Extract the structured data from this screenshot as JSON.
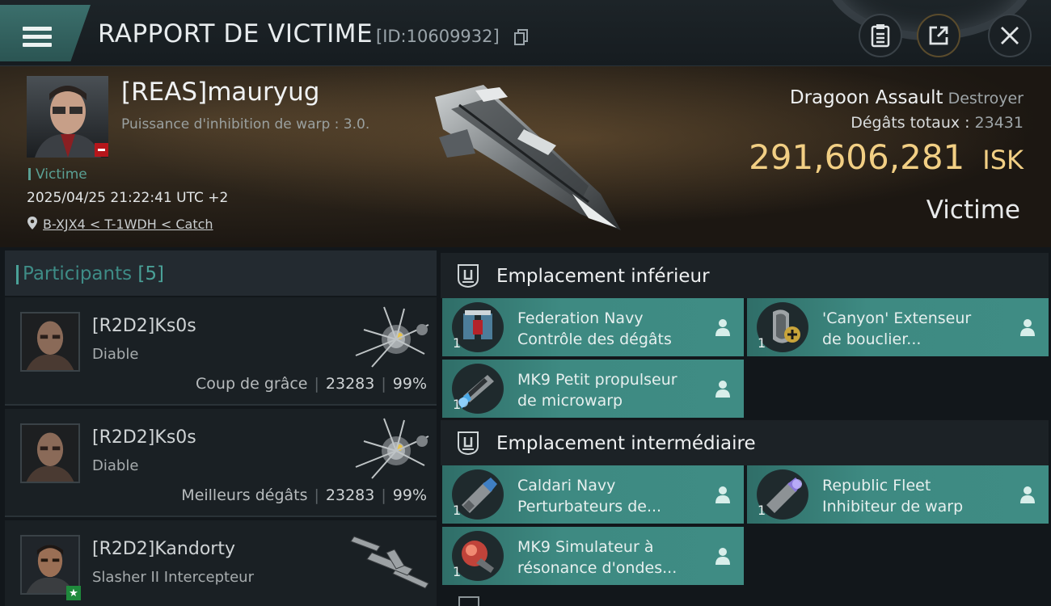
{
  "header": {
    "title": "RAPPORT DE VICTIME",
    "report_id": "[ID:10609932]",
    "icons": [
      "menu-icon",
      "copy-icon",
      "clipboard-icon",
      "share-icon",
      "close-icon"
    ]
  },
  "victim": {
    "name": "[REAS]mauryug",
    "subtitle": "Puissance d'inhibition de warp : 3.0.",
    "tag": "Victime",
    "datetime": "2025/04/25 21:22:41 UTC +2",
    "location": "B-XJX4 < T-1WDH < Catch",
    "ship_name": "Dragoon Assault",
    "ship_class": "Destroyer",
    "total_damage_label": "Dégâts totaux :",
    "total_damage": "23431",
    "isk_value": "291,606,281",
    "isk_unit": "ISK",
    "outcome_label": "Victime"
  },
  "participants": {
    "label": "Participants",
    "count": "[5]",
    "items": [
      {
        "name": "[R2D2]Ks0s",
        "ship": "Diable",
        "stat_label": "Coup de grâce",
        "damage": "23283",
        "percent": "99%"
      },
      {
        "name": "[R2D2]Ks0s",
        "ship": "Diable",
        "stat_label": "Meilleurs dégâts",
        "damage": "23283",
        "percent": "99%"
      },
      {
        "name": "[R2D2]Kandorty",
        "ship": "Slasher II Intercepteur"
      }
    ]
  },
  "fitting": {
    "low_slot_title": "Emplacement inférieur",
    "mid_slot_title": "Emplacement intermédiaire",
    "low_modules": [
      {
        "qty": "1",
        "line1": "Federation Navy",
        "line2": "Contrôle des dégâts"
      },
      {
        "qty": "1",
        "line1": "'Canyon' Extenseur",
        "line2": "de bouclier..."
      },
      {
        "qty": "1",
        "line1": "MK9 Petit propulseur",
        "line2": "de microwarp"
      }
    ],
    "mid_modules": [
      {
        "qty": "1",
        "line1": "Caldari Navy",
        "line2": "Perturbateurs de..."
      },
      {
        "qty": "1",
        "line1": "Republic Fleet",
        "line2": "Inhibiteur de warp"
      },
      {
        "qty": "1",
        "line1": "MK9 Simulateur à",
        "line2": "résonance d'ondes..."
      }
    ]
  },
  "colors": {
    "accent_teal": "#3f8c84",
    "isk_gold": "#f2cf84",
    "victim_red": "#b5161b"
  }
}
